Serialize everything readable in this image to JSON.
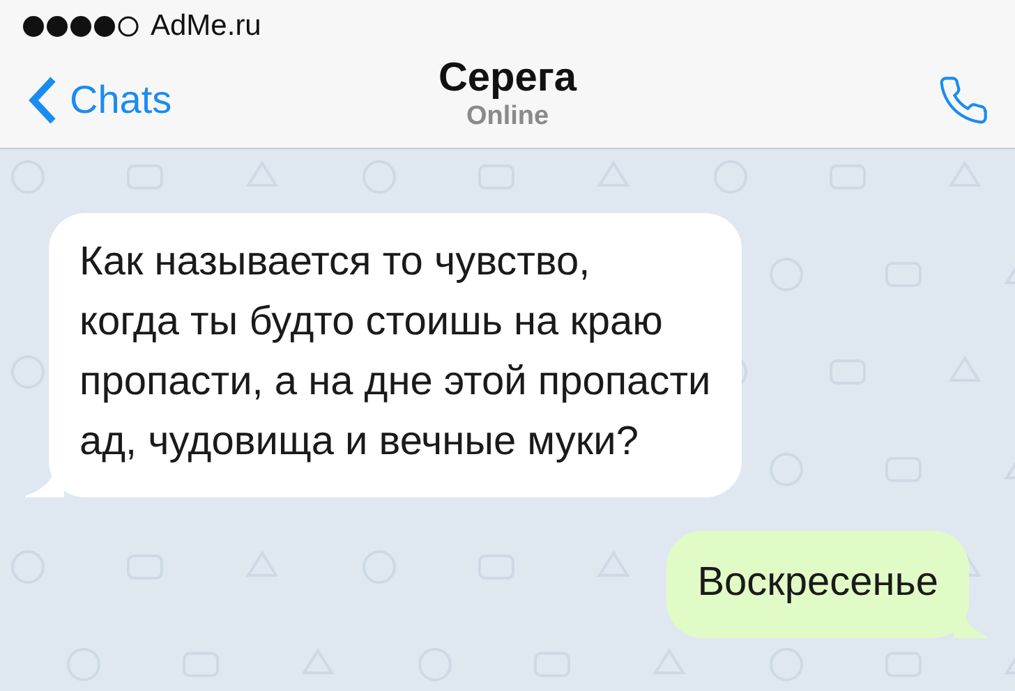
{
  "status_bar": {
    "carrier": "AdMe.ru"
  },
  "nav_bar": {
    "back": "Chats",
    "title": "Серега",
    "subtitle": "Online"
  },
  "messages": [
    {
      "kind": "incoming",
      "text": "Как называется то чувство,\nкогда ты будто стоишь на краю\nпропасти, а на дне этой пропасти\nад, чудовища и вечные муки?"
    },
    {
      "kind": "outgoing",
      "text": "Воскресенье"
    }
  ]
}
